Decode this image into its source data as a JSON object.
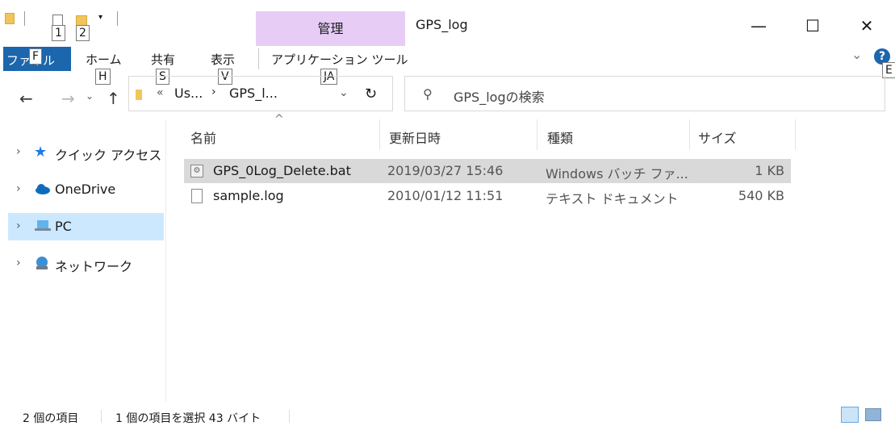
{
  "window": {
    "title": "GPS_log",
    "contextual_group": "管理",
    "controls": {
      "minimize": "—",
      "maximize": "☐",
      "close": "✕"
    }
  },
  "quick_access": {
    "keytips": [
      "1",
      "2"
    ]
  },
  "ribbon": {
    "tabs": [
      {
        "label": "ファイル",
        "keytip": "F"
      },
      {
        "label": "ホーム",
        "keytip": "H"
      },
      {
        "label": "共有",
        "keytip": "S"
      },
      {
        "label": "表示",
        "keytip": "V"
      },
      {
        "label": "アプリケーション ツール",
        "keytip": "JA"
      }
    ],
    "help_keytip": "E"
  },
  "address_bar": {
    "crumbs": [
      "«",
      "Us...",
      "GPS_l..."
    ]
  },
  "search": {
    "placeholder": "GPS_logの検索"
  },
  "nav_pane": {
    "items": [
      {
        "label": "クイック アクセス",
        "icon": "star-icon"
      },
      {
        "label": "OneDrive",
        "icon": "cloud-icon"
      },
      {
        "label": "PC",
        "icon": "computer-icon",
        "selected": true
      },
      {
        "label": "ネットワーク",
        "icon": "network-icon"
      }
    ]
  },
  "file_list": {
    "columns": [
      "名前",
      "更新日時",
      "種類",
      "サイズ"
    ],
    "sort_indicator": "^",
    "rows": [
      {
        "name": "GPS_0Log_Delete.bat",
        "modified": "2019/03/27 15:46",
        "type": "Windows バッチ ファ...",
        "size": "1 KB",
        "icon": "batch-file-icon",
        "selected": true
      },
      {
        "name": "sample.log",
        "modified": "2010/01/12 11:51",
        "type": "テキスト ドキュメント",
        "size": "540 KB",
        "icon": "text-file-icon",
        "selected": false
      }
    ]
  },
  "status": {
    "item_count": "2 個の項目",
    "selection": "1 個の項目を選択 43 バイト"
  },
  "colors": {
    "accent": "#1b66ad",
    "contextual_tab": "#e7cdf6",
    "selected_row": "#d9d9d9",
    "nav_selected": "#cce8ff"
  }
}
